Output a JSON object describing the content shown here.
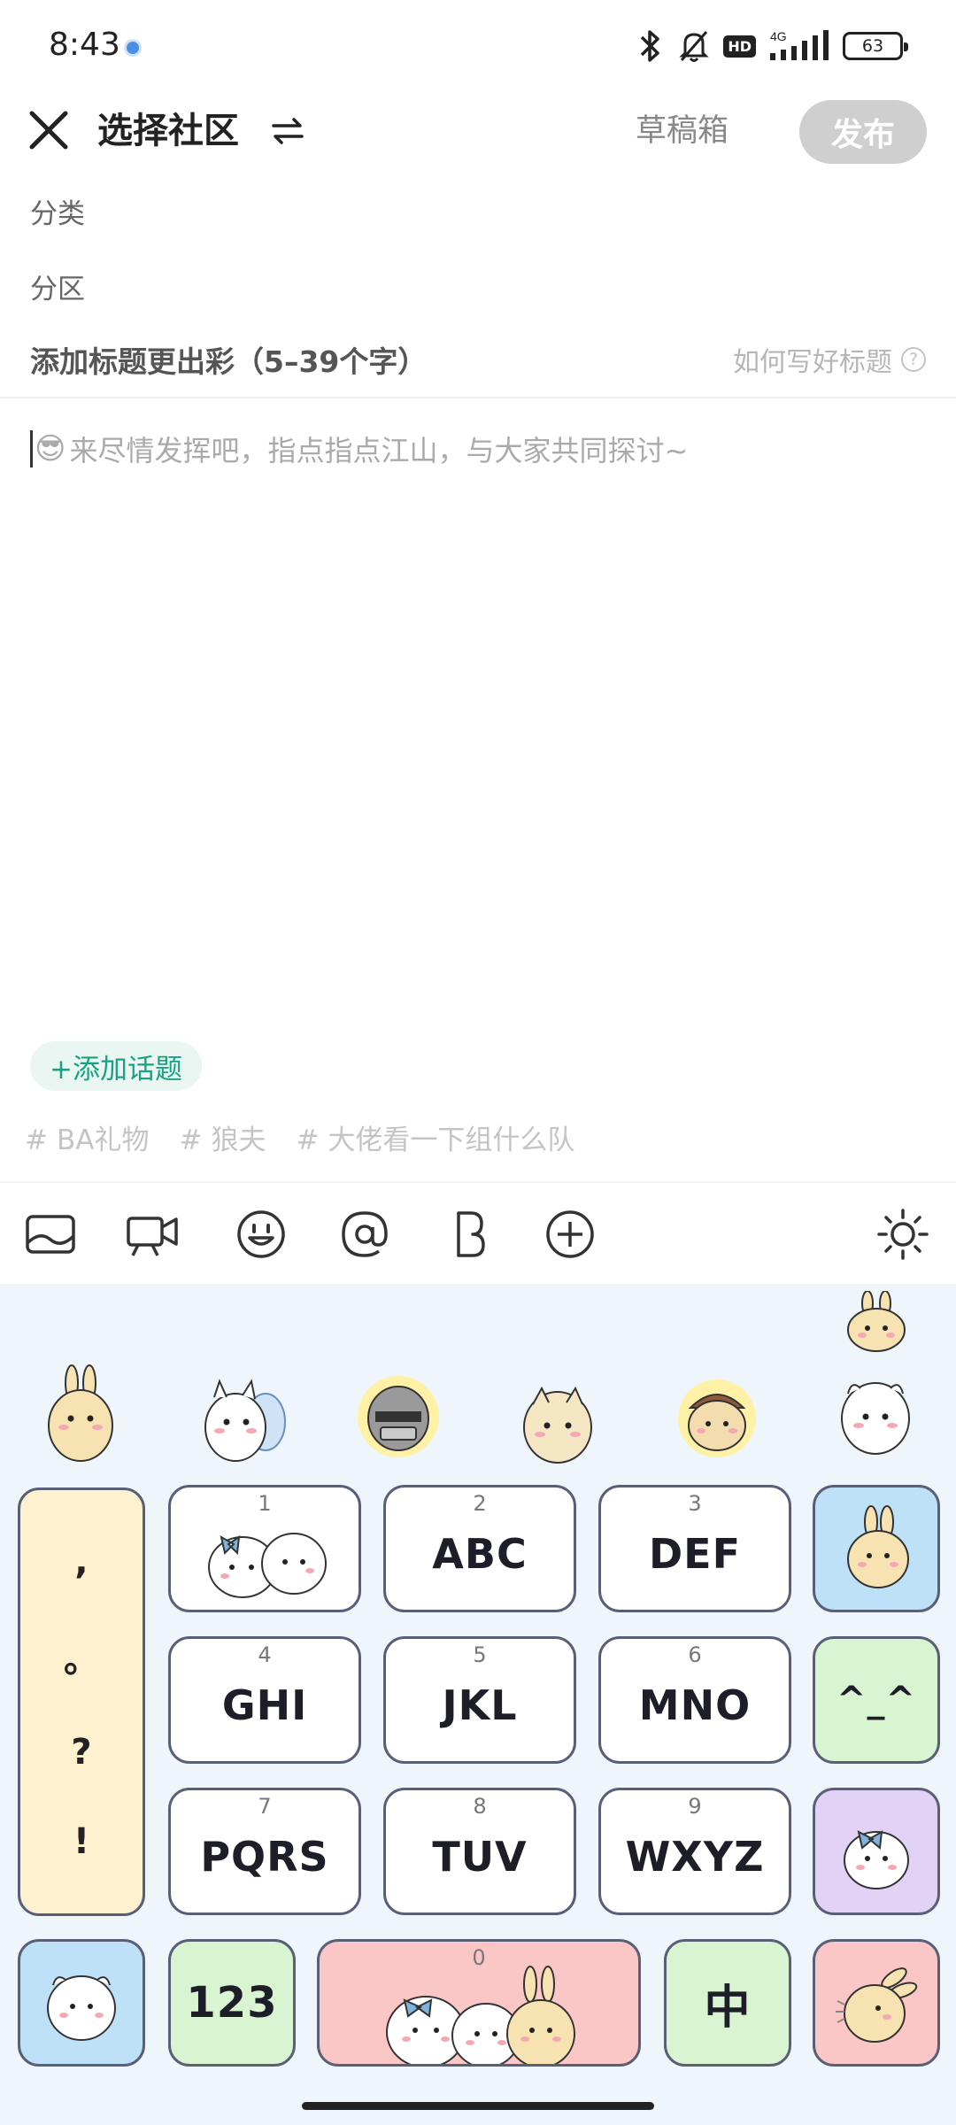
{
  "status_bar": {
    "time": "8:43",
    "hd": "HD",
    "network": "4G",
    "battery": "63"
  },
  "header": {
    "community_label": "选择社区",
    "draft_label": "草稿箱",
    "publish_label": "发布"
  },
  "form": {
    "category_label": "分类",
    "section_label": "分区",
    "title_placeholder": "添加标题更出彩（5–39个字）",
    "title_help": "如何写好标题",
    "body_emoji": "😎",
    "body_placeholder": "来尽情发挥吧，指点指点江山，与大家共同探讨~",
    "add_topic_label": "+添加话题",
    "tags": [
      "BA礼物",
      "狼夫",
      "大佬看一下组什么队"
    ],
    "tag_hash": "#"
  },
  "toolbar": {
    "icons": [
      "image-icon",
      "video-icon",
      "emoji-icon",
      "mention-icon",
      "bold-icon",
      "plus-circle-icon",
      "theme-brightness-icon"
    ]
  },
  "keyboard": {
    "punctuation": [
      ",",
      "。",
      "?",
      "!"
    ],
    "keys": [
      {
        "num": "1",
        "label": ""
      },
      {
        "num": "2",
        "label": "ABC"
      },
      {
        "num": "3",
        "label": "DEF"
      },
      {
        "num": "4",
        "label": "GHI"
      },
      {
        "num": "5",
        "label": "JKL"
      },
      {
        "num": "6",
        "label": "MNO"
      },
      {
        "num": "7",
        "label": "PQRS"
      },
      {
        "num": "8",
        "label": "TUV"
      },
      {
        "num": "9",
        "label": "WXYZ"
      },
      {
        "num": "0",
        "label": ""
      }
    ],
    "emoticon_key": "^_^",
    "numbers_key": "123",
    "chinese_key": "中",
    "colors": {
      "punct": "#fdf1cf",
      "blue": "#bfe1f7",
      "green": "#d9f4d0",
      "purple": "#e2d3f6",
      "pink": "#fbc7c6",
      "teal_accent": "#17a383"
    }
  }
}
